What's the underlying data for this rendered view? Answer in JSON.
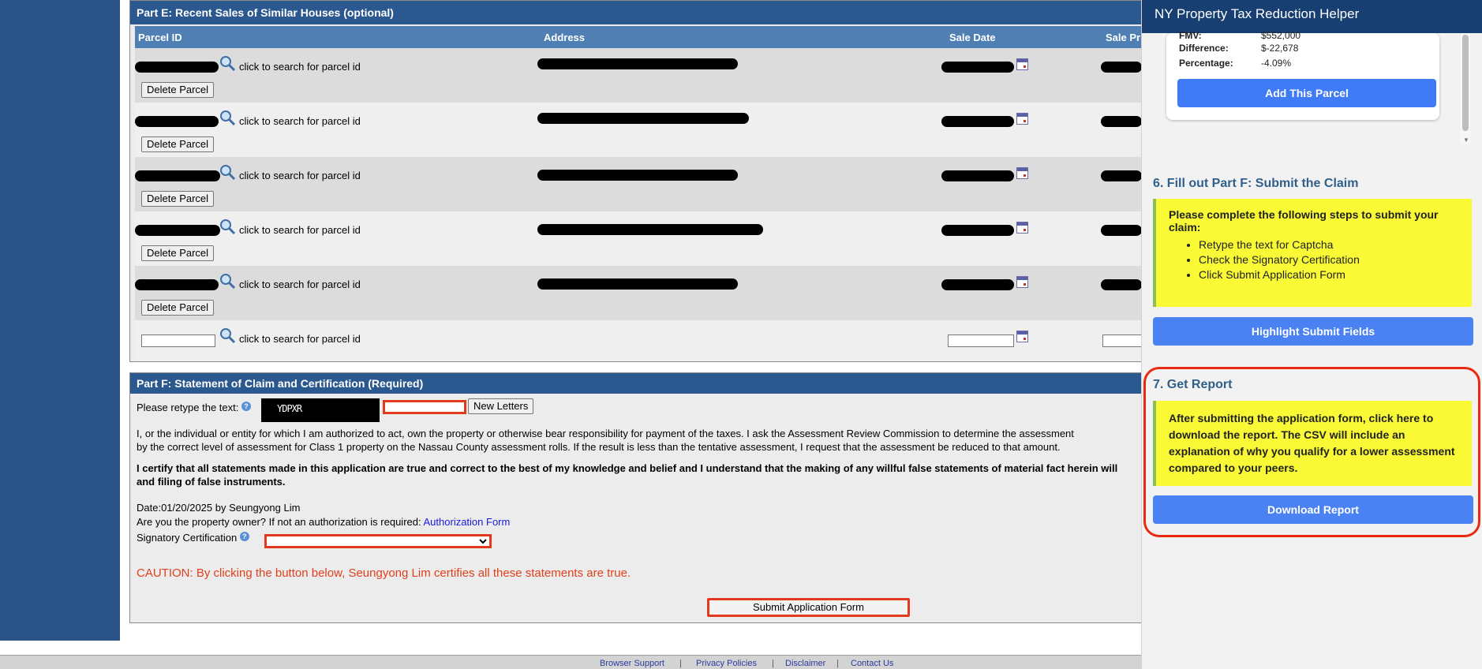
{
  "partE": {
    "title": "Part E: Recent Sales of Similar Houses (optional)",
    "columns": [
      "Parcel ID",
      "Address",
      "Sale Date",
      "Sale Price"
    ],
    "search_text": "click to search for parcel id",
    "delete_label": "Delete Parcel",
    "row_count_filled": 5
  },
  "partF": {
    "title": "Part F: Statement of Claim and Certification (Required)",
    "retype_label": "Please retype the text:",
    "captcha_text": "YDPXR",
    "new_letters_label": "New Letters",
    "statement_line1": "I, or the individual or entity for which I am authorized to act, own the property or otherwise bear responsibility for payment of the taxes. I ask the Assessment Review Commission to determine the assessment",
    "statement_line2": "by the correct level of assessment for Class 1 property on the Nassau County assessment rolls. If the result is less than the tentative assessment, I request that the assessment be reduced to that amount.",
    "certify_line1": "I certify that all statements made in this application are true and correct to the best of my knowledge and belief and I understand that the making of any willful false statements of material fact herein will",
    "certify_line2": "and filing of false instruments.",
    "date_line": "Date:01/20/2025  by Seungyong Lim",
    "owner_question": "Are you the property owner? If not an authorization is required:",
    "authorization_link": "Authorization Form",
    "signatory_label": "Signatory Certification",
    "caution": "CAUTION: By clicking the button below, Seungyong Lim certifies all these statements are true.",
    "submit_label": "Submit Application Form"
  },
  "footer": {
    "links": [
      "Browser Support",
      "Privacy Policies",
      "Disclaimer",
      "Contact Us"
    ],
    "separator": "|"
  },
  "helper": {
    "title": "NY Property Tax Reduction Helper",
    "card": {
      "fmv_label": "FMV:",
      "fmv_value": "$552,000",
      "diff_label": "Difference:",
      "diff_value": "$-22,678",
      "pct_label": "Percentage:",
      "pct_value": "-4.09%",
      "add_button": "Add This Parcel"
    },
    "step6": {
      "title": "6. Fill out Part F: Submit the Claim",
      "intro": "Please complete the following steps to submit your claim:",
      "items": [
        "Retype the text for Captcha",
        "Check the Signatory Certification",
        "Click Submit Application Form"
      ],
      "button": "Highlight Submit Fields"
    },
    "step7": {
      "title": "7. Get Report",
      "text": "After submitting the application form, click here to download the report. The CSV will include an explanation of why you qualify for a lower assessment compared to your peers.",
      "button": "Download Report"
    }
  },
  "colors": {
    "header_blue": "#2b588e",
    "table_head_blue": "#4f7fb3",
    "helper_header": "#173f72",
    "accent_button": "#3e7bf5",
    "highlight_red": "#e33a1e",
    "note_yellow": "#f9f936"
  }
}
